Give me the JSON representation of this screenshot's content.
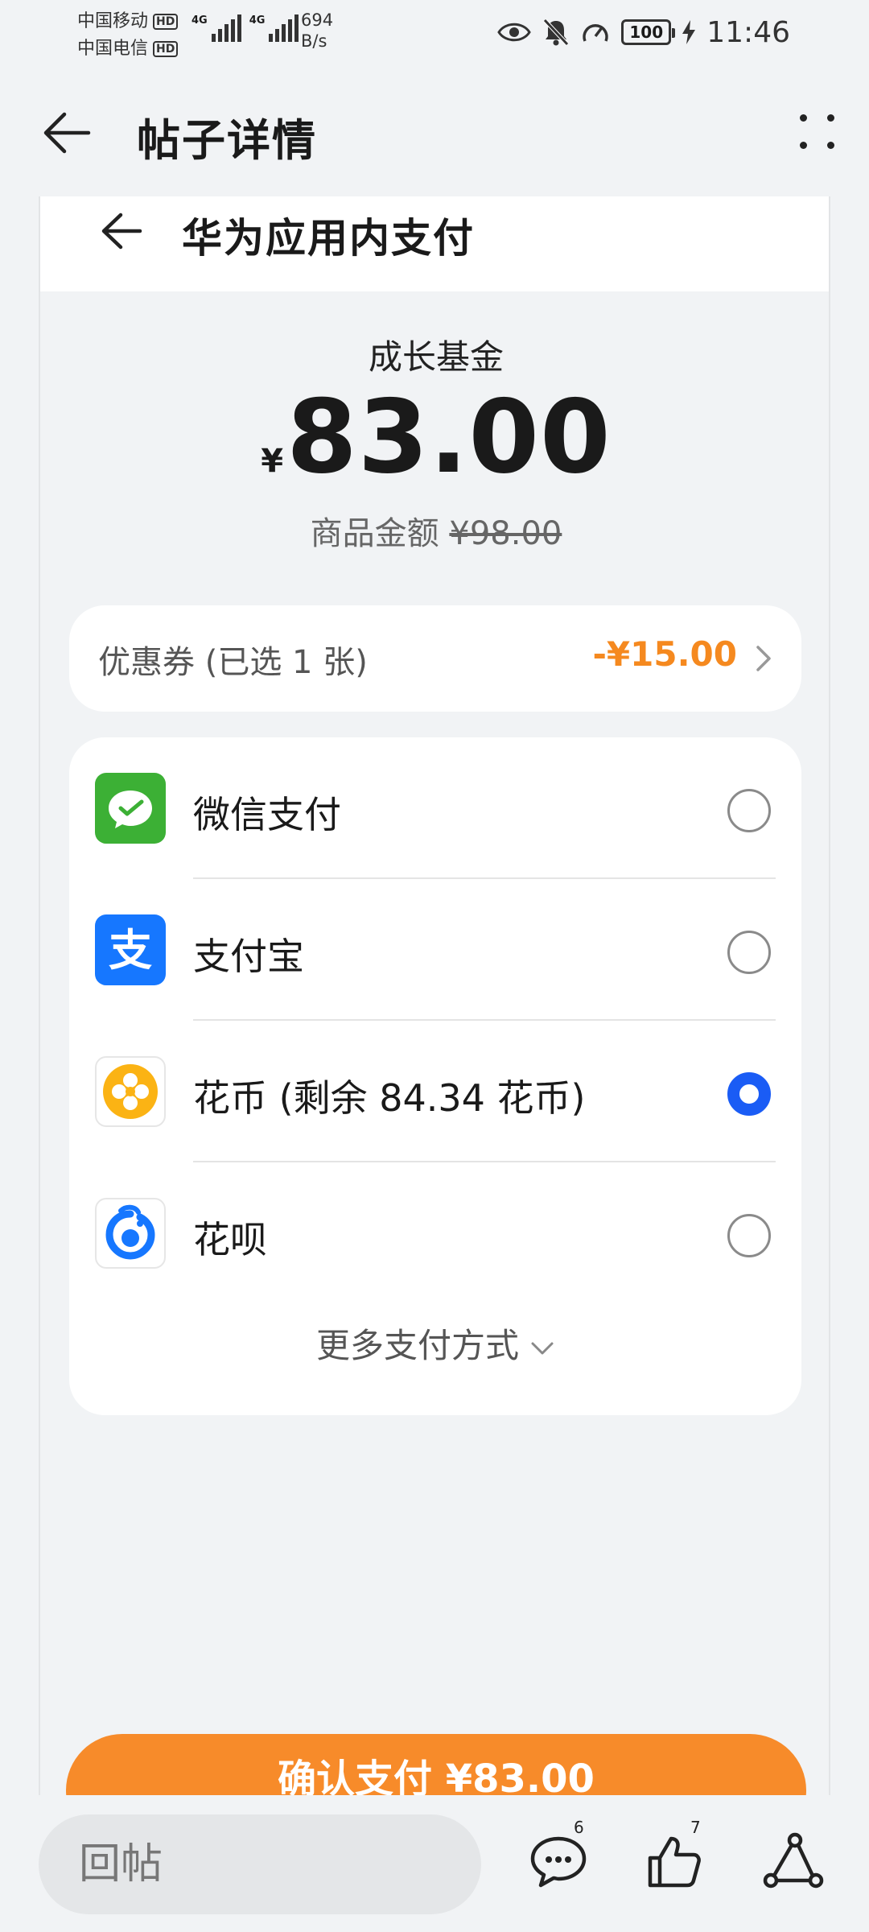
{
  "status_bar": {
    "carrier1": "中国移动",
    "carrier2": "中国电信",
    "hd": "HD",
    "net_type": "4G",
    "speed_value": "694",
    "speed_unit": "B/s",
    "battery": "100",
    "time": "11:46"
  },
  "header": {
    "title": "帖子详情"
  },
  "payment": {
    "title": "华为应用内支付",
    "product": "成长基金",
    "currency": "¥",
    "amount": "83.00",
    "original_label": "商品金额",
    "original_price": "¥98.00",
    "coupon_label": "优惠券 (已选 1 张)",
    "coupon_value": "-¥15.00",
    "methods": [
      {
        "label": "微信支付",
        "selected": false,
        "icon": "wechat-pay-icon"
      },
      {
        "label": "支付宝",
        "selected": false,
        "icon": "alipay-icon"
      },
      {
        "label": "花币 (剩余 84.34 花币)",
        "selected": true,
        "icon": "huawei-coin-icon"
      },
      {
        "label": "花呗",
        "selected": false,
        "icon": "huabei-icon"
      }
    ],
    "more_methods": "更多支付方式",
    "confirm": "确认支付 ¥83.00"
  },
  "bottom_bar": {
    "reply_placeholder": "回帖",
    "comment_count": "6",
    "like_count": "7"
  },
  "colors": {
    "accent_orange": "#f78b2a",
    "coupon_orange": "#f5891f",
    "radio_blue": "#1a5cf5",
    "wechat_green": "#3cb035",
    "alipay_blue": "#1677ff",
    "coin_yellow": "#fbb314"
  }
}
